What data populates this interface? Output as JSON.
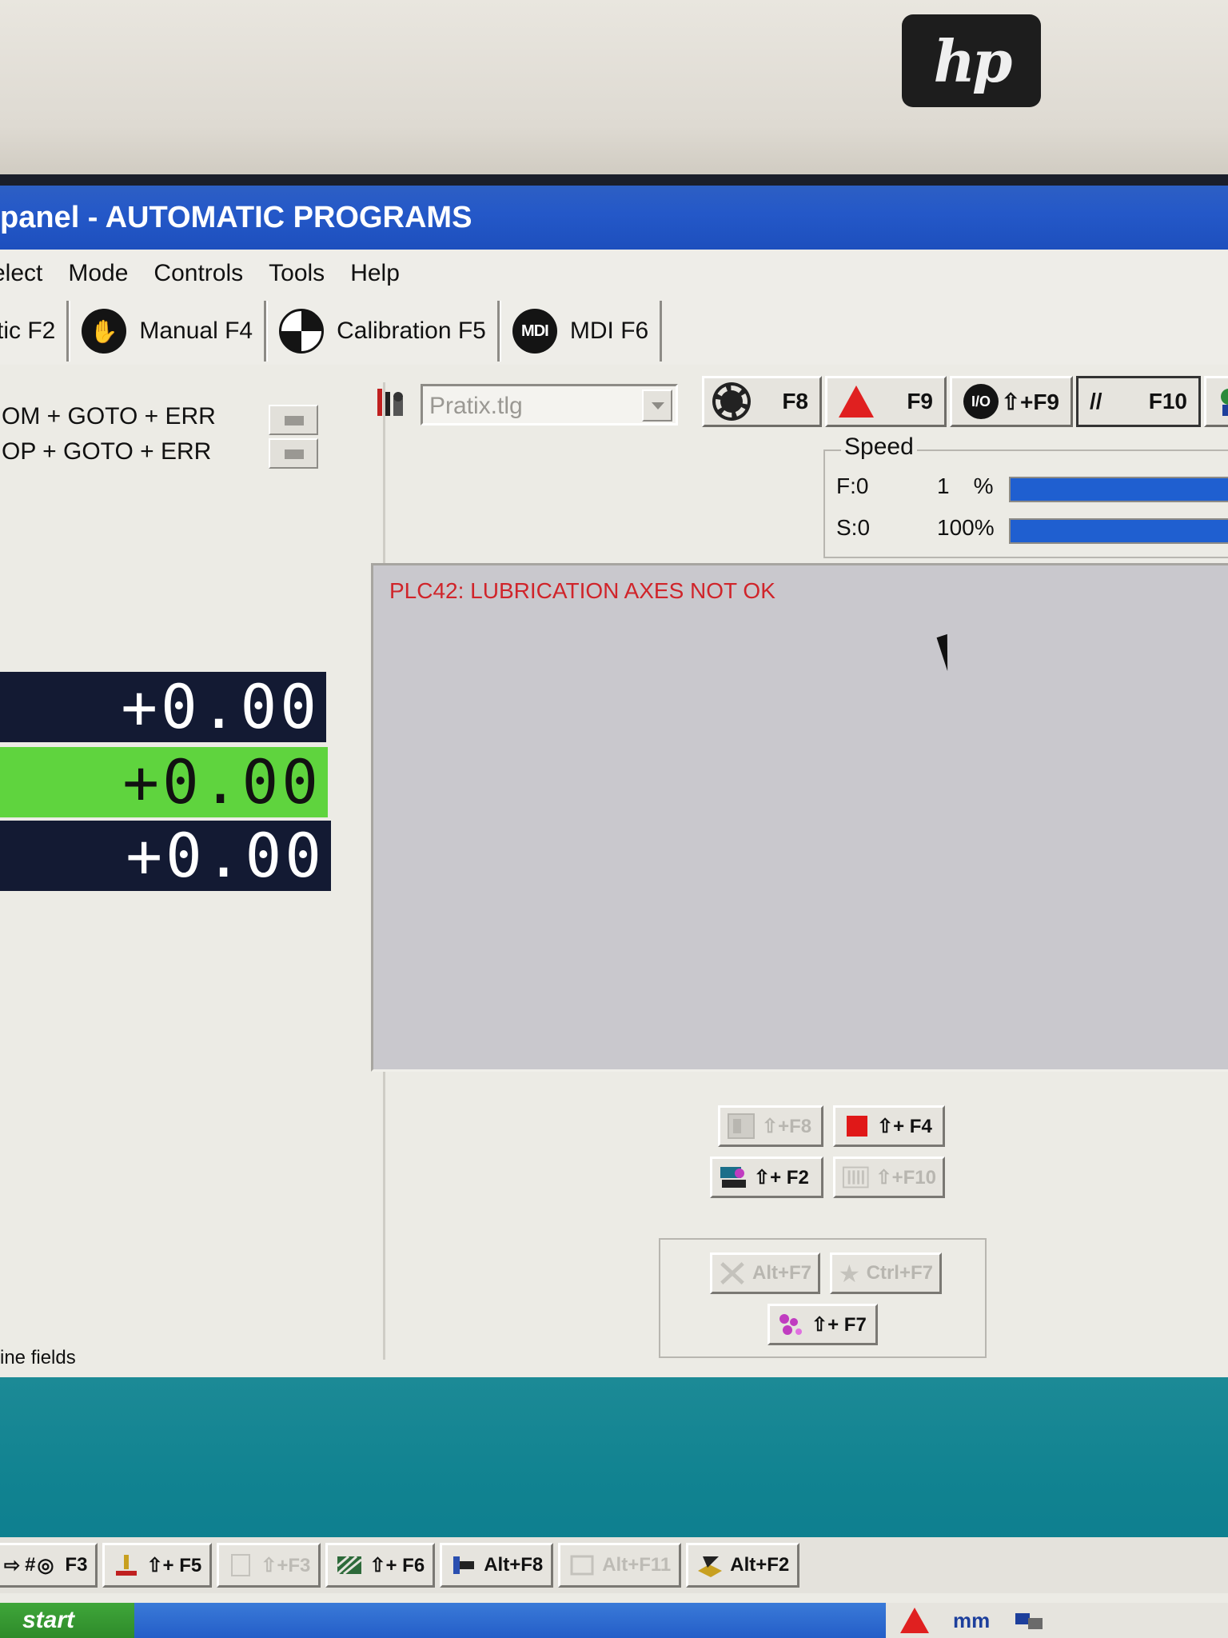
{
  "window": {
    "title": "panel - AUTOMATIC PROGRAMS"
  },
  "menu": [
    "elect",
    "Mode",
    "Controls",
    "Tools",
    "Help"
  ],
  "tabs": [
    {
      "label": "tic F2"
    },
    {
      "label": "Manual F4",
      "icon": "hand-icon"
    },
    {
      "label": "Calibration F5",
      "icon": "calibration-icon"
    },
    {
      "label": "MDI F6",
      "icon": "mdi-icon",
      "icon_text": "MDI"
    }
  ],
  "conditions": [
    "OM + GOTO + ERR",
    "OP + GOTO + ERR"
  ],
  "coordinates": [
    "+0.00",
    "+0.00",
    "+0.00"
  ],
  "tool_file": {
    "value": "Pratix.tlg"
  },
  "fkeys": {
    "f8": "F8",
    "f9": "F9",
    "shift_f9": "⇧+F9",
    "io_icon_text": "I/O",
    "f10_symbol": "//",
    "f10": "F10"
  },
  "speed": {
    "legend": "Speed",
    "f_label": "F:0",
    "f_pct": "1",
    "f_pct_suffix": "%",
    "f_level": 1.0,
    "s_label": "S:0",
    "s_pct": "100",
    "s_pct_suffix": "%",
    "s_level": 1.0
  },
  "message": "PLC42: LUBRICATION AXES NOT OK",
  "shortcuts": {
    "shift_f8": "⇧+F8",
    "shift_f4": "⇧+ F4",
    "shift_f2": "⇧+ F2",
    "shift_f10": "⇧+F10",
    "alt_f7": "Alt+F7",
    "ctrl_f7": "Ctrl+F7",
    "shift_f7": "⇧+ F7"
  },
  "status_fields": "ine fields",
  "bottom_toolbar": {
    "f3": "F3",
    "f3_prefix": "#",
    "shift_f5": "⇧+ F5",
    "shift_f3": "⇧+F3",
    "shift_f6": "⇧+ F6",
    "alt_f8": "Alt+F8",
    "alt_f11": "Alt+F11",
    "alt_f2": "Alt+F2"
  },
  "taskbar": {
    "start": "start",
    "units": "mm"
  },
  "colors": {
    "title_blue": "#2458c8",
    "coord_dark": "#131a33",
    "coord_green": "#5fd43e",
    "message_red": "#d0242a",
    "desktop_teal": "#118391"
  }
}
